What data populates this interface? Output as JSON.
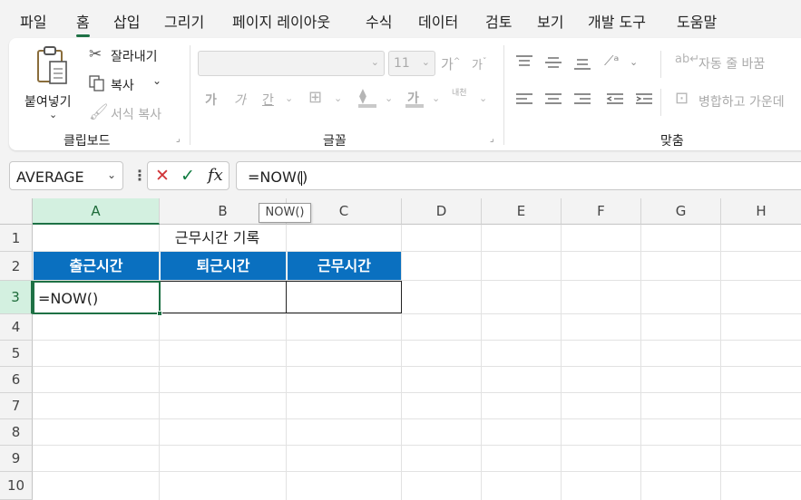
{
  "menu_tabs": [
    "파일",
    "홈",
    "삽입",
    "그리기",
    "페이지 레이아웃",
    "수식",
    "데이터",
    "검토",
    "보기",
    "개발 도구",
    "도움말"
  ],
  "active_tab": "홈",
  "ribbon": {
    "clipboard": {
      "paste": "붙여넣기",
      "cut": "잘라내기",
      "copy": "복사",
      "format_painter": "서식 복사",
      "label": "클립보드"
    },
    "font": {
      "font_size": "11",
      "bold": "가",
      "italic": "가",
      "underline": "간",
      "font_color": "가",
      "phonetic": "내천",
      "grow_font": "가",
      "shrink_font": "가",
      "label": "글꼴"
    },
    "alignment": {
      "wrap_text": "자동 줄 바꿈",
      "merge_center": "병합하고 가운데",
      "label": "맞춤"
    }
  },
  "formula_bar": {
    "name_box": "AVERAGE",
    "cancel": "✕",
    "enter": "✓",
    "fx": "fx",
    "formula": "=NOW()"
  },
  "tooltip": "NOW()",
  "grid": {
    "columns": [
      "A",
      "B",
      "C",
      "D",
      "E",
      "F",
      "G",
      "H"
    ],
    "rows": [
      "1",
      "2",
      "3",
      "4",
      "5",
      "6",
      "7",
      "8",
      "9",
      "10"
    ],
    "selected_column": "A",
    "selected_row": "3",
    "title": "근무시간 기록",
    "headers": [
      "출근시간",
      "퇴근시간",
      "근무시간"
    ],
    "active_cell_value": "=NOW()"
  },
  "colors": {
    "accent_green": "#1e7145",
    "header_blue": "#0a70c0",
    "cancel_red": "#d13438",
    "enter_green": "#107c41"
  }
}
